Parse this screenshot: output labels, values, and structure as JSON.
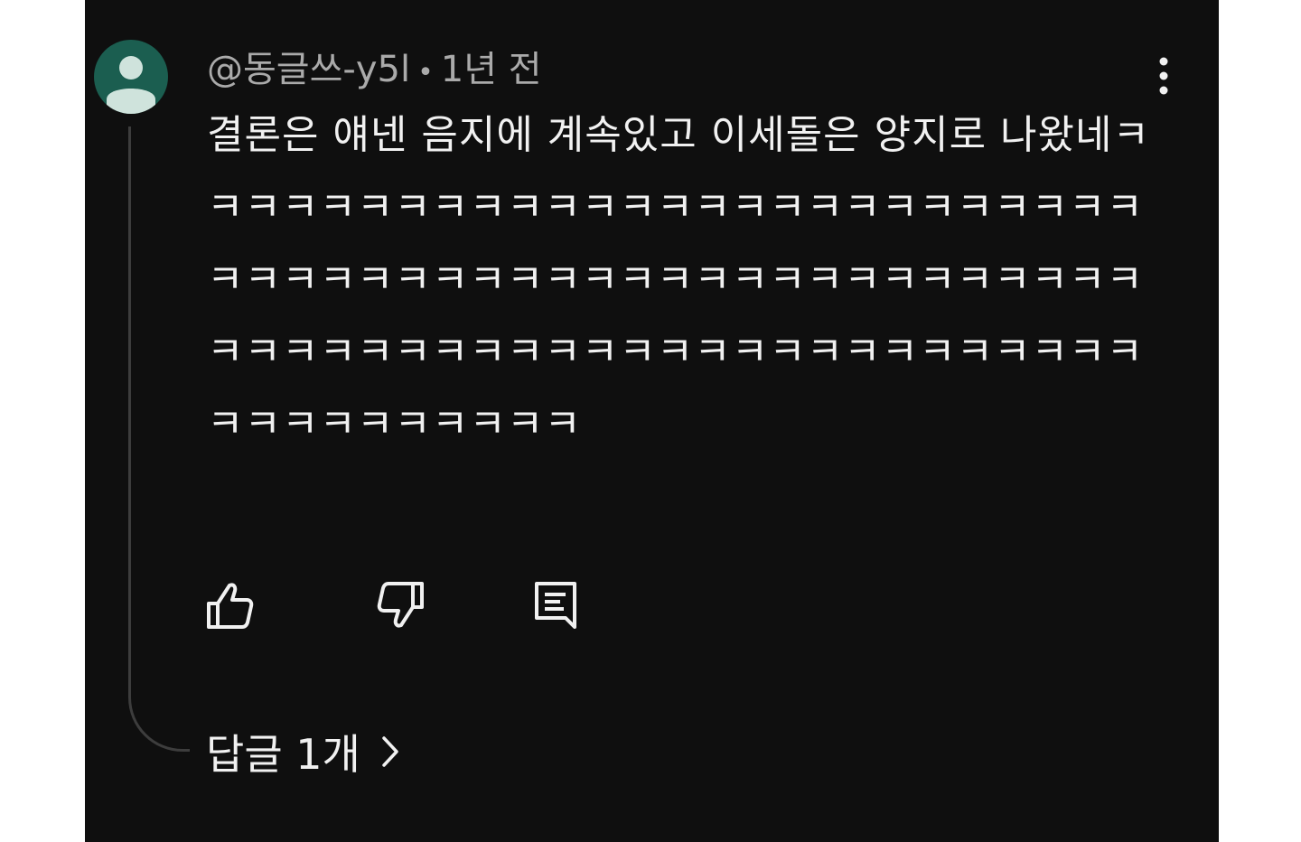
{
  "comment": {
    "author": "@동글쓰-y5l",
    "separator": "•",
    "time": "1년 전",
    "text": "결론은 얘넨 음지에 계속있고 이세돌은 양지로 나왔네ㅋㅋㅋㅋㅋㅋㅋㅋㅋㅋㅋㅋㅋㅋㅋㅋㅋㅋㅋㅋㅋㅋㅋㅋㅋㅋㅋㅋㅋㅋㅋㅋㅋㅋㅋㅋㅋㅋㅋㅋㅋㅋㅋㅋㅋㅋㅋㅋㅋㅋㅋㅋㅋㅋㅋㅋㅋㅋㅋㅋㅋㅋㅋㅋㅋㅋㅋㅋㅋㅋㅋㅋㅋㅋㅋㅋㅋㅋㅋㅋㅋㅋㅋㅋㅋㅋ",
    "replies_label": "답글 1개"
  },
  "colors": {
    "background": "#0f0f0f",
    "text": "#f1f1f1",
    "meta_text": "#aaaaaa",
    "avatar_bg": "#1b5e50",
    "avatar_fg": "#cfe3dc"
  },
  "icons": {
    "avatar": "default-user-icon",
    "more": "more-vertical-icon",
    "like": "thumbs-up-icon",
    "dislike": "thumbs-down-icon",
    "reply": "comment-icon",
    "replies": "chevron-right-icon"
  }
}
